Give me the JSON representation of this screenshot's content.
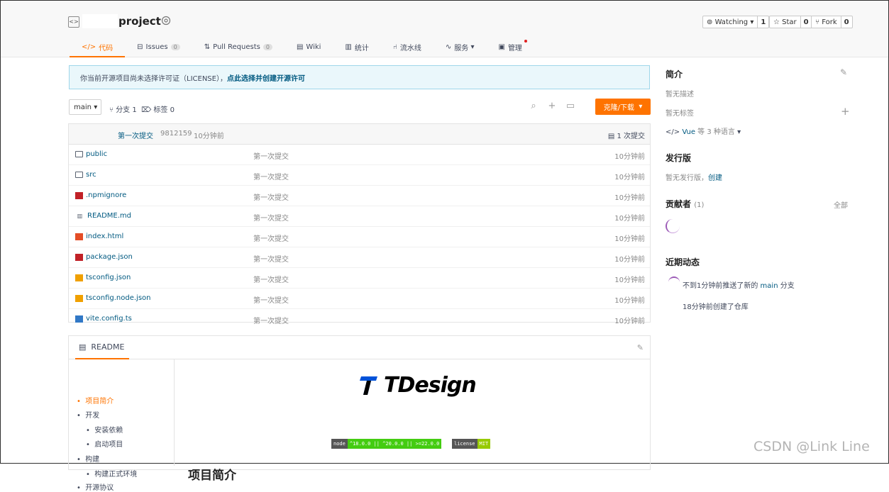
{
  "repo": {
    "name": "project"
  },
  "header_buttons": {
    "watching": {
      "label": "Watching",
      "count": "1"
    },
    "star": {
      "label": "Star",
      "count": "0"
    },
    "fork": {
      "label": "Fork",
      "count": "0"
    }
  },
  "tabs": [
    {
      "label": "代码",
      "icon": "code-icon"
    },
    {
      "label": "Issues",
      "badge": "0",
      "icon": "issues-icon"
    },
    {
      "label": "Pull Requests",
      "badge": "0",
      "icon": "pull-request-icon"
    },
    {
      "label": "Wiki",
      "icon": "wiki-icon"
    },
    {
      "label": "统计",
      "icon": "stats-icon"
    },
    {
      "label": "流水线",
      "icon": "pipeline-icon"
    },
    {
      "label": "服务",
      "icon": "services-icon"
    },
    {
      "label": "管理",
      "icon": "manage-icon"
    }
  ],
  "notice": {
    "text": "你当前开源项目尚未选择许可证（LICENSE），",
    "link": "点此选择并创建开源许可"
  },
  "branch": {
    "current": "main",
    "branches_label": "分支 1",
    "tags_label": "标签 0"
  },
  "clone_button": "克隆/下载",
  "last_commit": {
    "message": "第一次提交",
    "hash": "9812159",
    "time": "10分钟前",
    "count": "1 次提交"
  },
  "files": [
    {
      "name": "public",
      "type": "folder",
      "message": "第一次提交",
      "time": "10分钟前"
    },
    {
      "name": "src",
      "type": "folder",
      "message": "第一次提交",
      "time": "10分钟前"
    },
    {
      "name": ".npmignore",
      "type": "npm",
      "message": "第一次提交",
      "time": "10分钟前"
    },
    {
      "name": "README.md",
      "type": "md",
      "message": "第一次提交",
      "time": "10分钟前"
    },
    {
      "name": "index.html",
      "type": "html",
      "message": "第一次提交",
      "time": "10分钟前"
    },
    {
      "name": "package.json",
      "type": "npm",
      "message": "第一次提交",
      "time": "10分钟前"
    },
    {
      "name": "tsconfig.json",
      "type": "json",
      "message": "第一次提交",
      "time": "10分钟前"
    },
    {
      "name": "tsconfig.node.json",
      "type": "json",
      "message": "第一次提交",
      "time": "10分钟前"
    },
    {
      "name": "vite.config.ts",
      "type": "ts",
      "message": "第一次提交",
      "time": "10分钟前"
    }
  ],
  "readme": {
    "tab_label": "README",
    "toc": [
      "项目简介",
      "开发",
      "安装依赖",
      "启动项目",
      "构建",
      "构建正式环境",
      "开源协议"
    ],
    "logo_text": "TDesign",
    "shields": {
      "node": {
        "key": "node",
        "value": "^18.0.0 || ^20.0.0 || >=22.0.0"
      },
      "license": {
        "key": "license",
        "value": "MIT"
      }
    },
    "heading": "项目简介"
  },
  "sidebar": {
    "intro_title": "简介",
    "no_description": "暂无描述",
    "no_tags": "暂无标签",
    "language": "Vue",
    "language_suffix": "等 3 种语言",
    "release_title": "发行版",
    "no_release": "暂无发行版，",
    "create_label": "创建",
    "contributors_title": "贡献者",
    "contributors_count": "(1)",
    "all_label": "全部",
    "activity_title": "近期动态",
    "activity": [
      {
        "text_pre": "不到1分钟前推送了新的 ",
        "branch": "main",
        "text_post": " 分支"
      },
      {
        "text": "18分钟前创建了仓库"
      }
    ]
  },
  "watermark": "CSDN @Link Line"
}
